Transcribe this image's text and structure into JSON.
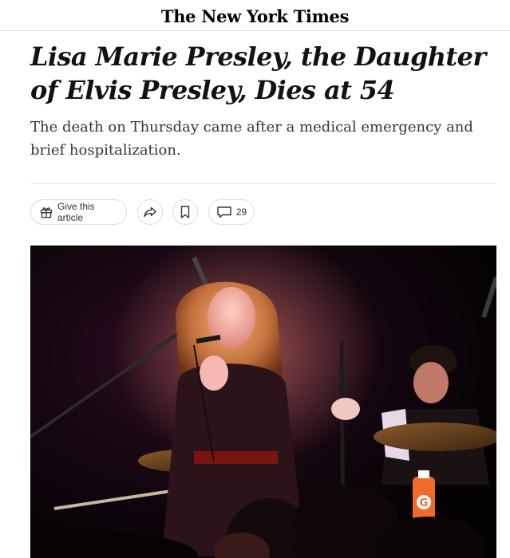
{
  "masthead": {
    "logo": "The New York Times"
  },
  "article": {
    "headline": "Lisa Marie Presley, the Daughter of Elvis Presley, Dies at 54",
    "summary": "The death on Thursday came after a medical emergency and brief hospitalization."
  },
  "toolbar": {
    "gift_label": "Give this article",
    "gift_icon": "gift-icon",
    "share_icon": "share-icon",
    "save_icon": "bookmark-icon",
    "comments_icon": "comment-icon",
    "comments_count": "29"
  },
  "photo": {
    "bottle_label": "G"
  }
}
